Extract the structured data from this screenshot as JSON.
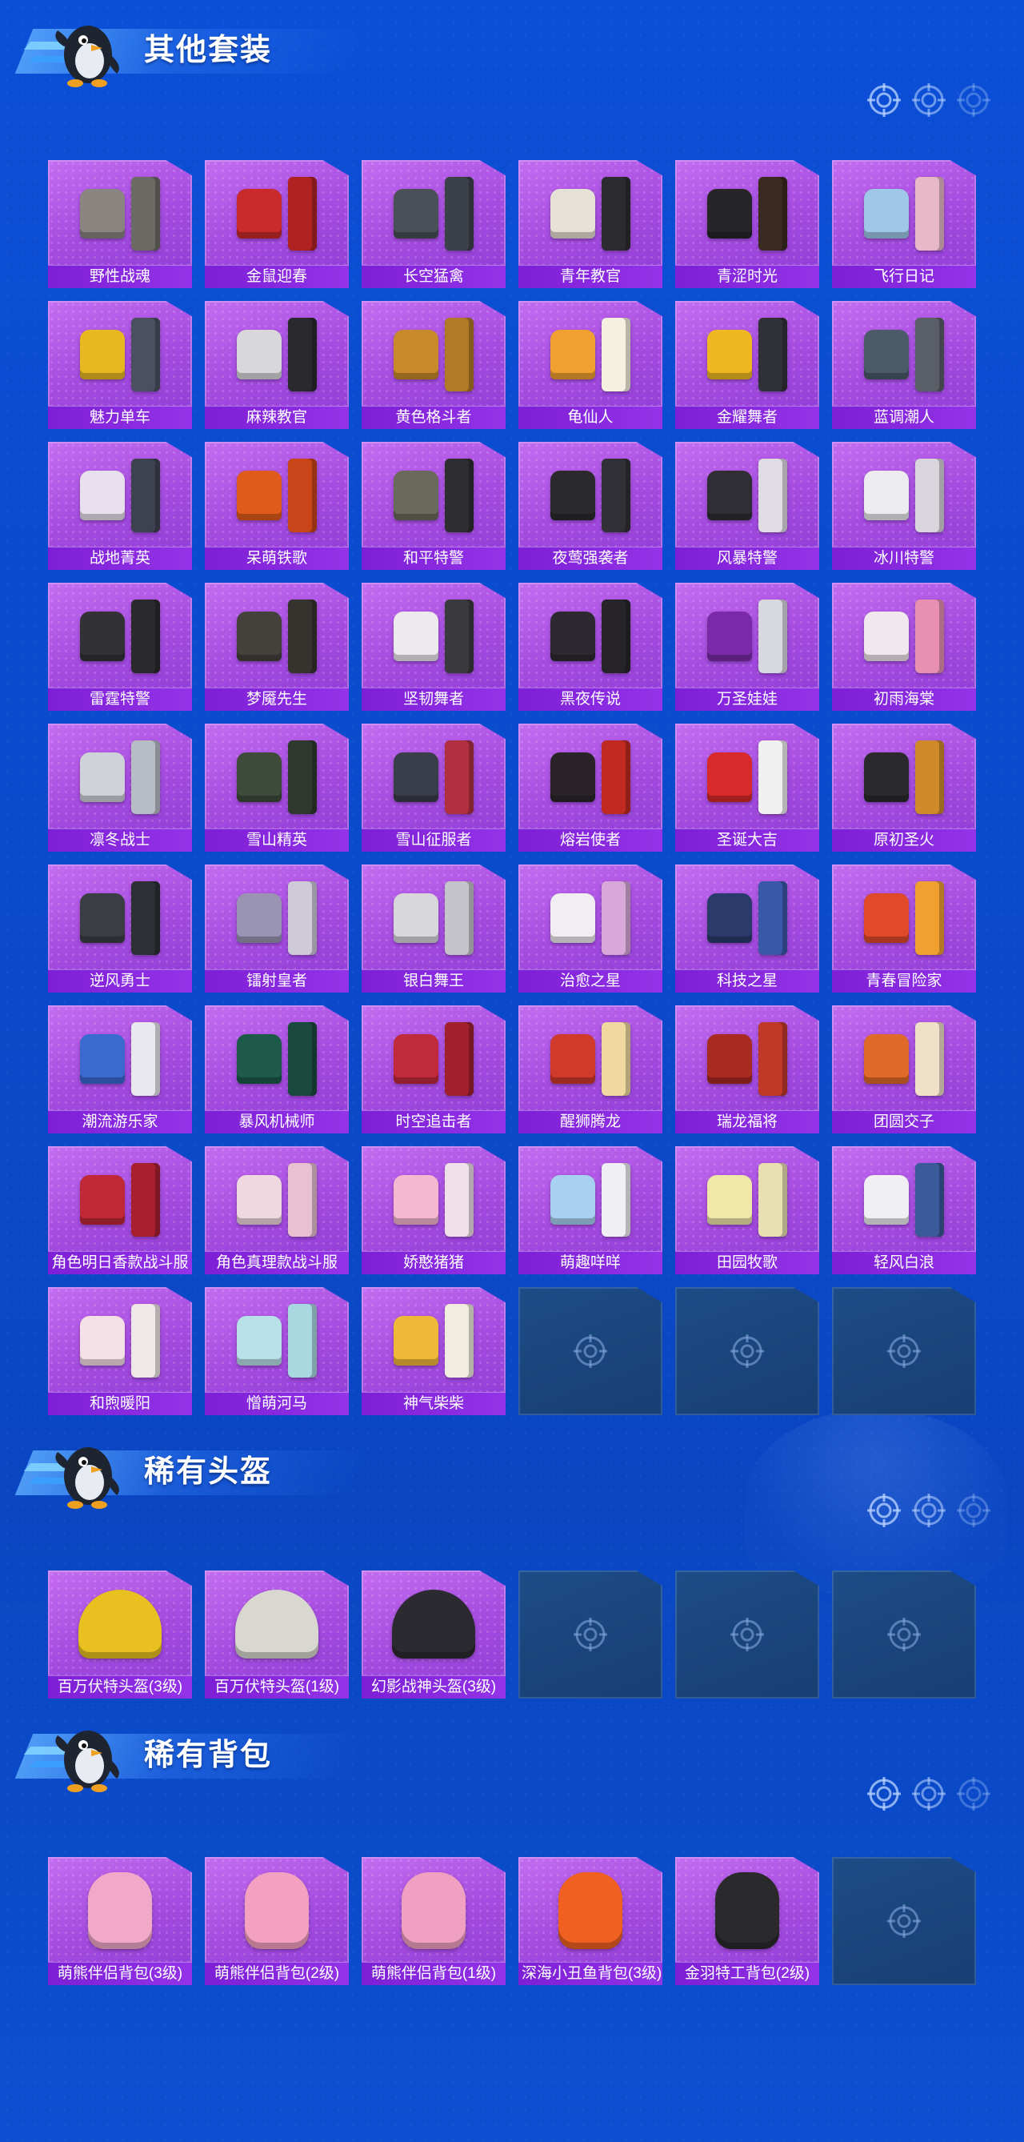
{
  "sections": [
    {
      "title": "其他套装",
      "items": [
        {
          "name": "野性战魂",
          "top": "#8a8580",
          "bottom": "#6c6a64"
        },
        {
          "name": "金鼠迎春",
          "top": "#c92a2a",
          "bottom": "#b02222"
        },
        {
          "name": "长空猛禽",
          "top": "#4a5058",
          "bottom": "#3c4048"
        },
        {
          "name": "青年教官",
          "top": "#e6e1d6",
          "bottom": "#2c2c30"
        },
        {
          "name": "青涩时光",
          "top": "#262628",
          "bottom": "#3a2a22"
        },
        {
          "name": "飞行日记",
          "top": "#9fc7e8",
          "bottom": "#e8b8c8"
        },
        {
          "name": "魅力单车",
          "top": "#e8b820",
          "bottom": "#4a5060"
        },
        {
          "name": "麻辣教官",
          "top": "#d8d8dc",
          "bottom": "#2a2a2e"
        },
        {
          "name": "黄色格斗者",
          "top": "#c88a2a",
          "bottom": "#b07a26"
        },
        {
          "name": "龟仙人",
          "top": "#f0a030",
          "bottom": "#f6f0e0"
        },
        {
          "name": "金耀舞者",
          "top": "#f0b820",
          "bottom": "#303038"
        },
        {
          "name": "蓝调潮人",
          "top": "#4a5a68",
          "bottom": "#5a5e66"
        },
        {
          "name": "战地菁英",
          "top": "#e8e0ec",
          "bottom": "#3e4250"
        },
        {
          "name": "呆萌铁歌",
          "top": "#e05a1a",
          "bottom": "#c8451a"
        },
        {
          "name": "和平特警",
          "top": "#6a6a5c",
          "bottom": "#2e2e30"
        },
        {
          "name": "夜莺强袭者",
          "top": "#2a2a2e",
          "bottom": "#303036"
        },
        {
          "name": "风暴特警",
          "top": "#2e2e34",
          "bottom": "#e0dce4"
        },
        {
          "name": "冰川特警",
          "top": "#ecebef",
          "bottom": "#d8d6dc"
        },
        {
          "name": "雷霆特警",
          "top": "#323236",
          "bottom": "#2a2a2c"
        },
        {
          "name": "梦魇先生",
          "top": "#44403c",
          "bottom": "#36322e"
        },
        {
          "name": "坚韧舞者",
          "top": "#eceaec",
          "bottom": "#3a3a3e"
        },
        {
          "name": "黑夜传说",
          "top": "#2c2a30",
          "bottom": "#262428"
        },
        {
          "name": "万圣娃娃",
          "top": "#7a2aa8",
          "bottom": "#d8d8e0"
        },
        {
          "name": "初雨海棠",
          "top": "#f0e8ee",
          "bottom": "#e890b0"
        },
        {
          "name": "凛冬战士",
          "top": "#cfd2d8",
          "bottom": "#b8bcc4"
        },
        {
          "name": "雪山精英",
          "top": "#3e4a3a",
          "bottom": "#2e382c"
        },
        {
          "name": "雪山征服者",
          "top": "#3a3e4a",
          "bottom": "#b03040"
        },
        {
          "name": "熔岩使者",
          "top": "#2a2428",
          "bottom": "#c02a20"
        },
        {
          "name": "圣诞大吉",
          "top": "#d82a2a",
          "bottom": "#f0f0f0"
        },
        {
          "name": "原初圣火",
          "top": "#2a2a2e",
          "bottom": "#d08a2a"
        },
        {
          "name": "逆风勇士",
          "top": "#3a3e44",
          "bottom": "#2c3034"
        },
        {
          "name": "镭射皇者",
          "top": "#9a94b4",
          "bottom": "#cfcad8"
        },
        {
          "name": "银白舞王",
          "top": "#d8d8dc",
          "bottom": "#c4c4ca"
        },
        {
          "name": "治愈之星",
          "top": "#f0eef2",
          "bottom": "#d8a8d8"
        },
        {
          "name": "科技之星",
          "top": "#2a3a6a",
          "bottom": "#3a58a8"
        },
        {
          "name": "青春冒险家",
          "top": "#e04a2a",
          "bottom": "#f0a030"
        },
        {
          "name": "潮流游乐家",
          "top": "#3a6ad0",
          "bottom": "#e8e8ee"
        },
        {
          "name": "暴风机械师",
          "top": "#1e5a4a",
          "bottom": "#1a4a3e"
        },
        {
          "name": "时空追击者",
          "top": "#c02a3a",
          "bottom": "#a0202e"
        },
        {
          "name": "醒狮腾龙",
          "top": "#d03a2a",
          "bottom": "#f0d8a0"
        },
        {
          "name": "瑞龙福将",
          "top": "#a82a20",
          "bottom": "#c03828"
        },
        {
          "name": "团圆交子",
          "top": "#e06a2a",
          "bottom": "#f0e0c8"
        },
        {
          "name": "角色明日香款战斗服",
          "top": "#c02838",
          "bottom": "#a82030"
        },
        {
          "name": "角色真理款战斗服",
          "top": "#f0d8e0",
          "bottom": "#e8c0d0"
        },
        {
          "name": "娇憨猪猪",
          "top": "#f6b8d0",
          "bottom": "#f0e0ea"
        },
        {
          "name": "萌趣咩咩",
          "top": "#a8d0f0",
          "bottom": "#f0f0f4"
        },
        {
          "name": "田园牧歌",
          "top": "#f0e8a8",
          "bottom": "#e8e0b0"
        },
        {
          "name": "轻风白浪",
          "top": "#f0f0f4",
          "bottom": "#3a5a9a"
        },
        {
          "name": "和煦暖阳",
          "top": "#f6e0e8",
          "bottom": "#f0e8e8"
        },
        {
          "name": "憎萌河马",
          "top": "#b8e0e8",
          "bottom": "#a8d8e0"
        },
        {
          "name": "神气柴柴",
          "top": "#f0b838",
          "bottom": "#f0ece0"
        }
      ],
      "empty_slots": 3
    },
    {
      "title": "稀有头盔",
      "items": [
        {
          "name": "百万伏特头盔(3级)",
          "top": "#e8c020",
          "bottom": "#303030"
        },
        {
          "name": "百万伏特头盔(1级)",
          "top": "#d8d8d0",
          "bottom": "#e0b020"
        },
        {
          "name": "幻影战神头盔(3级)",
          "top": "#2a2a30",
          "bottom": "#f0f0f0"
        }
      ],
      "empty_slots": 3
    },
    {
      "title": "稀有背包",
      "items": [
        {
          "name": "萌熊伴侣背包(3级)",
          "top": "#f2a8c8",
          "bottom": "#f0b8d0"
        },
        {
          "name": "萌熊伴侣背包(2级)",
          "top": "#f4a0c0",
          "bottom": "#f0b0c8"
        },
        {
          "name": "萌熊伴侣背包(1级)",
          "top": "#f0a0c0",
          "bottom": "#e8a8c0"
        },
        {
          "name": "深海小丑鱼背包(3级)",
          "top": "#f06020",
          "bottom": "#f0f0f0"
        },
        {
          "name": "金羽特工背包(2级)",
          "top": "#2a2a2c",
          "bottom": "#e0b830"
        }
      ],
      "empty_slots": 1
    }
  ],
  "theme": {
    "card_purple": "#a54ce0",
    "name_bar": "#8a2be2",
    "empty_slot": "#1a4478",
    "background": "#0b4fd6"
  },
  "icons": {
    "header_mascot": "penguin-mascot-icon",
    "header_decor": "crosshair-icon",
    "empty_slot": "crosshair-icon"
  }
}
